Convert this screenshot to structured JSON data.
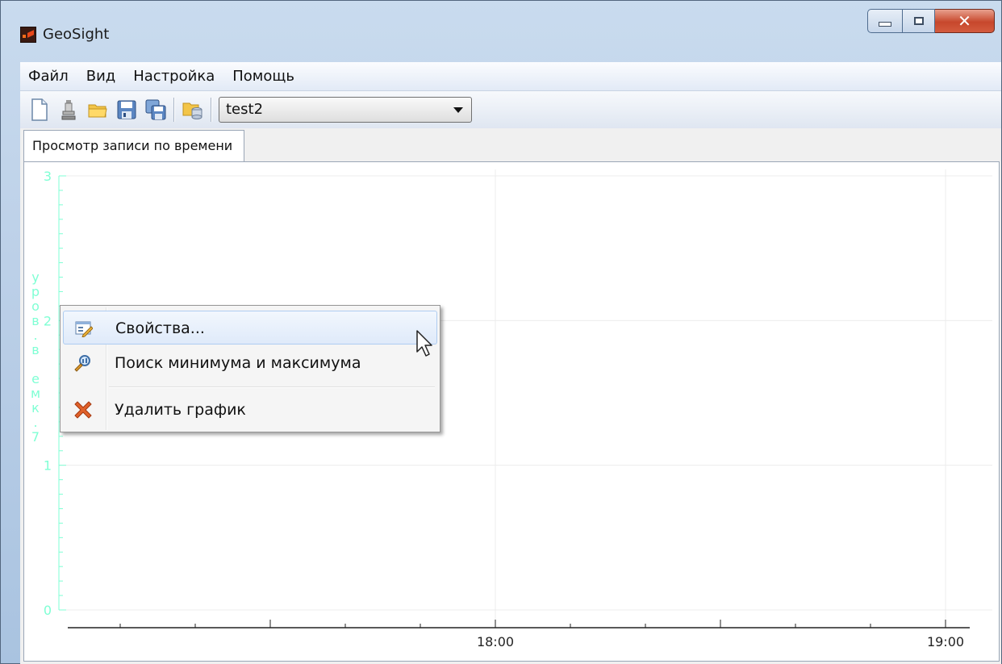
{
  "window": {
    "title": "GeoSight",
    "caption_buttons": [
      "minimize",
      "maximize",
      "close"
    ]
  },
  "menubar": {
    "items": [
      "Файл",
      "Вид",
      "Настройка",
      "Помощь"
    ]
  },
  "toolbar": {
    "buttons": [
      "new-file-icon",
      "pin-icon",
      "open-folder-icon",
      "save-icon",
      "save-all-icon",
      "folder-database-icon"
    ],
    "combo_value": "test2"
  },
  "tabs": [
    {
      "label": "Просмотр записи по времени",
      "active": true
    }
  ],
  "chart_data": {
    "type": "line",
    "ylabel_vertical": [
      "у",
      "р",
      "о",
      "в",
      ".",
      "в",
      " ",
      "е",
      "м",
      "к",
      ".",
      "7"
    ],
    "y_ticks": [
      "3",
      "2",
      "1",
      "0"
    ],
    "ylim": [
      0,
      3
    ],
    "x_ticks": [
      "18:00",
      "19:00"
    ],
    "series": [],
    "grid": true,
    "axis_color": "#7fffd4"
  },
  "context_menu": {
    "items": [
      {
        "label": "Свойства...",
        "icon": "properties-icon",
        "highlighted": true
      },
      {
        "label": "Поиск минимума и максимума",
        "icon": "search-minmax-icon",
        "highlighted": false
      },
      {
        "label": "Удалить график",
        "icon": "delete-icon",
        "highlighted": false
      }
    ]
  },
  "colors": {
    "accent": "#aeccf1",
    "axis_label": "#7fffd4",
    "delete": "#e0612a"
  }
}
